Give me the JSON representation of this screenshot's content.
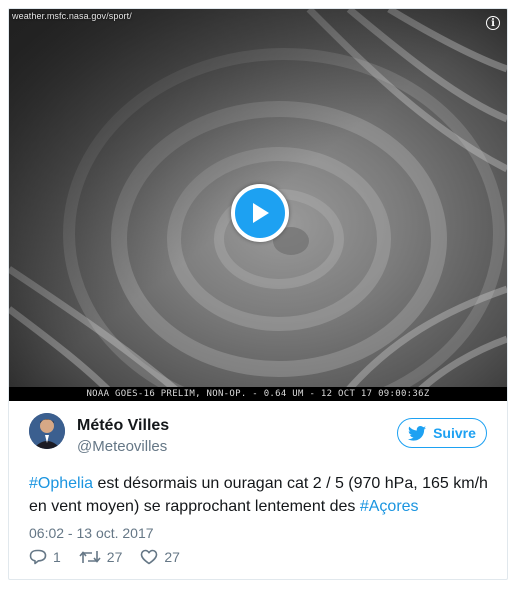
{
  "media": {
    "source_url": "weather.msfc.nasa.gov/sport/",
    "caption": "NOAA GOES-16 PRELIM, NON-OP. - 0.64 UM - 12 OCT 17 09:00:36Z",
    "info_icon": "info-icon",
    "play_icon": "play-icon",
    "play_color": "#1da1f2"
  },
  "author": {
    "name": "Météo Villes",
    "handle": "@Meteovilles",
    "avatar_icon": "avatar"
  },
  "follow": {
    "label": "Suivre",
    "icon": "twitter-bird-icon",
    "color": "#1da1f2"
  },
  "tweet": {
    "hashtag1": "#Ophelia",
    "text1": " est désormais un ouragan cat 2 / 5 (970 hPa, 165 km/h en vent moyen) se rapprochant lentement des ",
    "hashtag2": "#Açores",
    "hashtag_color": "#1b95e0",
    "timestamp": "06:02 - 13 oct. 2017"
  },
  "actions": {
    "reply_count": "1",
    "retweet_count": "27",
    "like_count": "27"
  }
}
